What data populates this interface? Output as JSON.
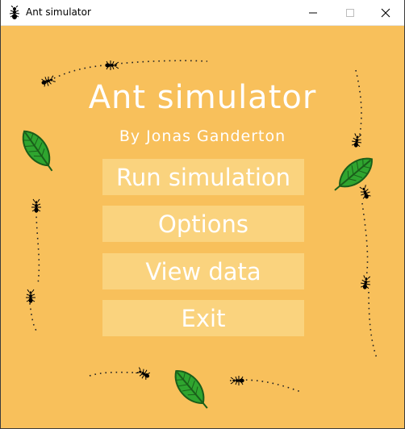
{
  "window": {
    "title": "Ant simulator",
    "controls": [
      "minimize",
      "maximize",
      "close"
    ]
  },
  "menu": {
    "title": "Ant simulator",
    "subtitle": "By Jonas Ganderton",
    "buttons": [
      "Run simulation",
      "Options",
      "View data",
      "Exit"
    ]
  },
  "decorations": {
    "icons": [
      "ant-icon",
      "leaf-icon"
    ],
    "background_color": "#f8c05b",
    "button_color": "#fad37e",
    "text_color": "#ffffff"
  }
}
